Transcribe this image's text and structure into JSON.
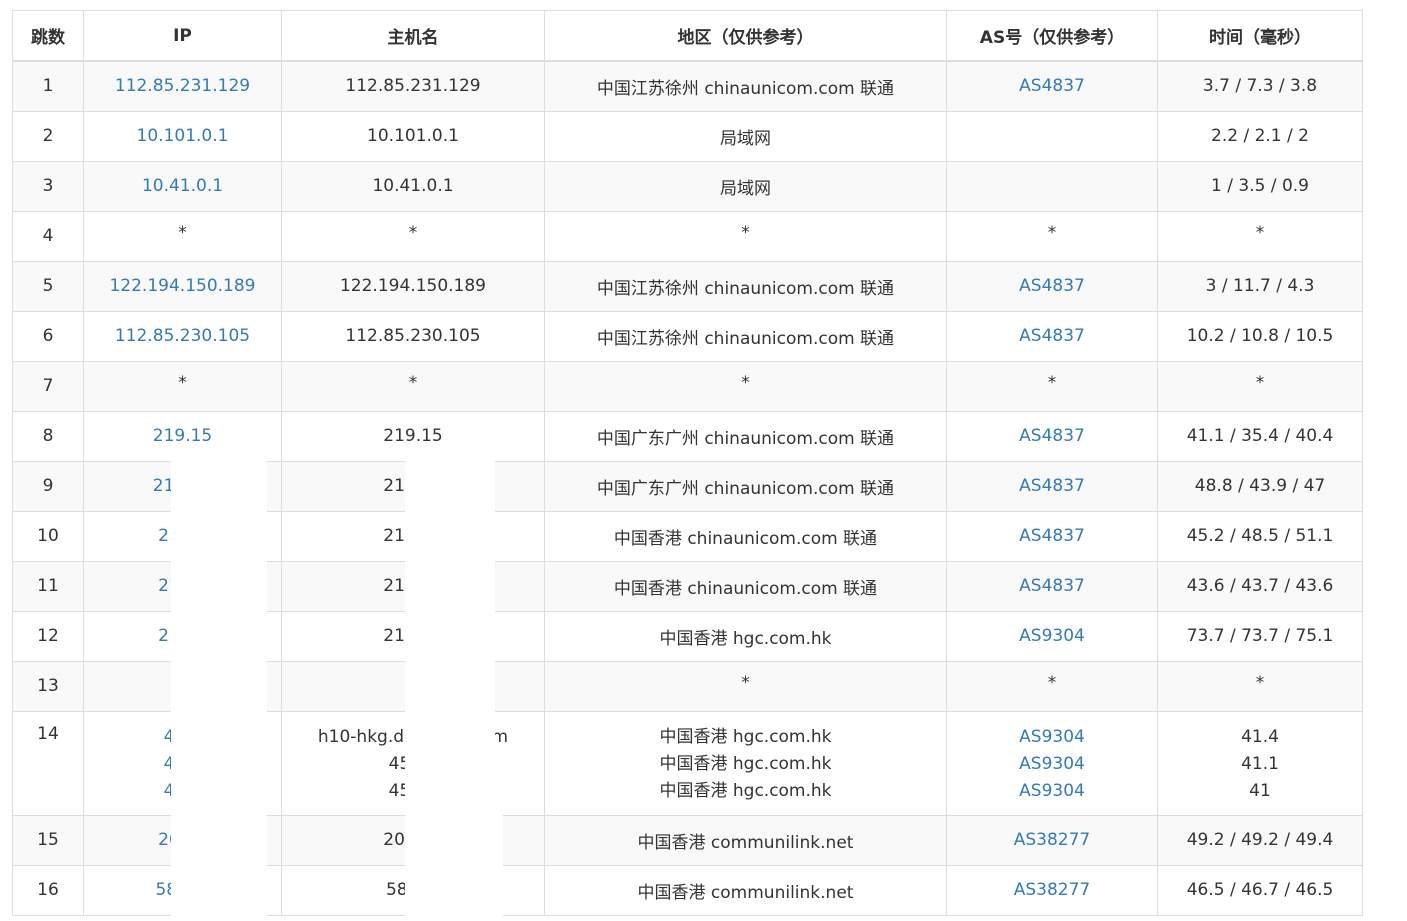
{
  "columns": [
    "跳数",
    "IP",
    "主机名",
    "地区（仅供参考）",
    "AS号（仅供参考）",
    "时间（毫秒）"
  ],
  "rows": [
    {
      "hop": "1",
      "ip": "112.85.231.129",
      "host": "112.85.231.129",
      "region": "中国江苏徐州 chinaunicom.com 联通",
      "as": "AS4837",
      "time": "3.7 / 7.3 / 3.8"
    },
    {
      "hop": "2",
      "ip": "10.101.0.1",
      "host": "10.101.0.1",
      "region": "局域网",
      "as": "",
      "time": "2.2 / 2.1 / 2"
    },
    {
      "hop": "3",
      "ip": "10.41.0.1",
      "host": "10.41.0.1",
      "region": "局域网",
      "as": "",
      "time": "1 / 3.5 / 0.9"
    },
    {
      "hop": "4",
      "ip": "*",
      "host": "*",
      "region": "*",
      "as": "*",
      "time": "*"
    },
    {
      "hop": "5",
      "ip": "122.194.150.189",
      "host": "122.194.150.189",
      "region": "中国江苏徐州 chinaunicom.com 联通",
      "as": "AS4837",
      "time": "3 / 11.7 / 4.3"
    },
    {
      "hop": "6",
      "ip": "112.85.230.105",
      "host": "112.85.230.105",
      "region": "中国江苏徐州 chinaunicom.com 联通",
      "as": "AS4837",
      "time": "10.2 / 10.8 / 10.5"
    },
    {
      "hop": "7",
      "ip": "*",
      "host": "*",
      "region": "*",
      "as": "*",
      "time": "*"
    },
    {
      "hop": "8",
      "ip": "219.15",
      "host": "219.15",
      "region": "中国广东广州 chinaunicom.com 联通",
      "as": "AS4837",
      "time": "41.1 / 35.4 / 40.4"
    },
    {
      "hop": "9",
      "ip": "219.15",
      "host": "219.15",
      "region": "中国广东广州 chinaunicom.com 联通",
      "as": "AS4837",
      "time": "48.8 / 43.9 / 47"
    },
    {
      "hop": "10",
      "ip": "219.1",
      "host": "219.15",
      "region": "中国香港 chinaunicom.com 联通",
      "as": "AS4837",
      "time": "45.2 / 48.5 / 51.1"
    },
    {
      "hop": "11",
      "ip": "219.1",
      "host": "219.15",
      "region": "中国香港 chinaunicom.com 联通",
      "as": "AS4837",
      "time": "43.6 / 43.7 / 43.6"
    },
    {
      "hop": "12",
      "ip": "218.1",
      "host": "218.18",
      "region": "中国香港 hgc.com.hk",
      "as": "AS9304",
      "time": "73.7 / 73.7 / 75.1"
    },
    {
      "hop": "13",
      "ip": "",
      "host": "*",
      "region": "*",
      "as": "*",
      "time": "*"
    },
    {
      "hop": "14",
      "ip": [
        "45.1",
        "45.1",
        "45.1"
      ],
      "host": [
        "h10-hkg.dataport.com",
        "45.12",
        "45.12"
      ],
      "region": [
        "中国香港 hgc.com.hk",
        "中国香港 hgc.com.hk",
        "中国香港 hgc.com.hk"
      ],
      "as": [
        "AS9304",
        "AS9304",
        "AS9304"
      ],
      "time": [
        "41.4",
        "41.1",
        "41"
      ]
    },
    {
      "hop": "15",
      "ip": "203.1",
      "host": "203.12",
      "region": "中国香港 communilink.net",
      "as": "AS38277",
      "time": "49.2 / 49.2 / 49.4"
    },
    {
      "hop": "16",
      "ip": "58.82.",
      "host": "58.82.",
      "region": "中国香港 communilink.net",
      "as": "AS38277",
      "time": "46.5 / 46.7 / 46.5"
    }
  ],
  "colors": {
    "link": "#337ab7",
    "text": "#333333",
    "border": "#dddddd",
    "stripe": "#f9f9f9"
  }
}
